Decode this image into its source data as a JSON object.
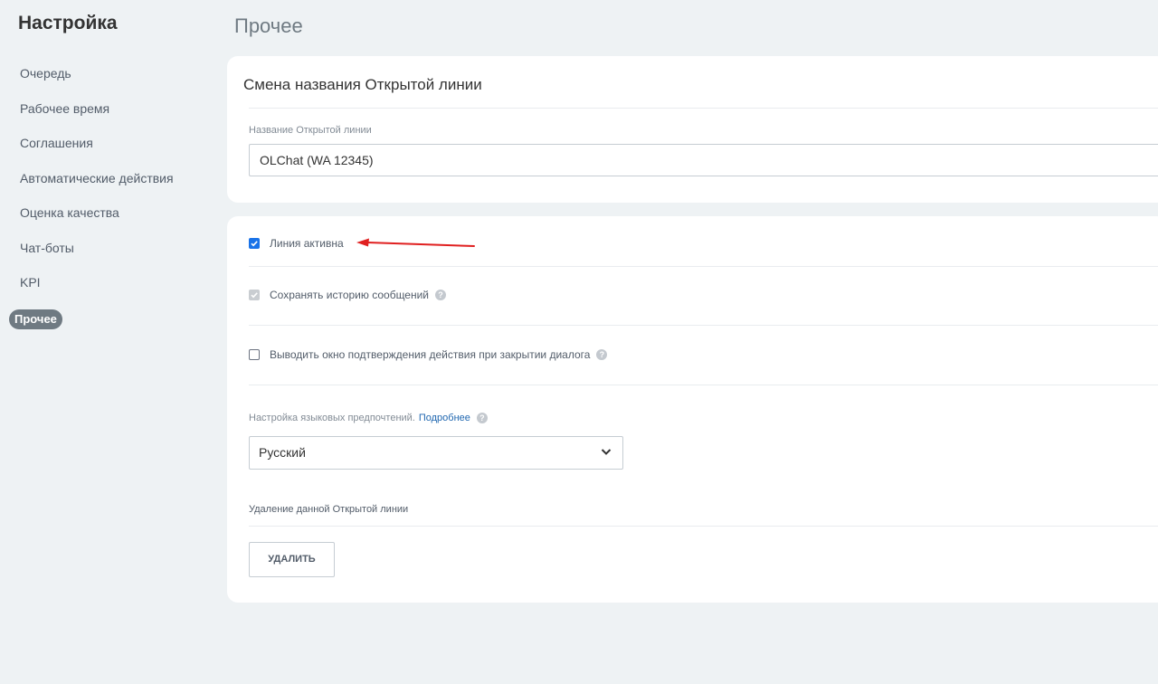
{
  "sidebar": {
    "title": "Настройка",
    "items": [
      {
        "label": "Очередь"
      },
      {
        "label": "Рабочее время"
      },
      {
        "label": "Соглашения"
      },
      {
        "label": "Автоматические действия"
      },
      {
        "label": "Оценка качества"
      },
      {
        "label": "Чат-боты"
      },
      {
        "label": "KPI"
      },
      {
        "label": "Прочее",
        "active": true
      }
    ]
  },
  "main": {
    "title": "Прочее",
    "rename_section": {
      "header": "Смена названия Открытой линии",
      "field_label": "Название Открытой линии",
      "field_value": "OLChat (WA 12345)"
    },
    "options": {
      "line_active": {
        "label": "Линия активна",
        "checked": true
      },
      "save_history": {
        "label": "Сохранять историю сообщений",
        "checked": true,
        "disabled": true
      },
      "confirm_close": {
        "label": "Выводить окно подтверждения действия при закрытии диалога",
        "checked": false
      },
      "language": {
        "label": "Настройка языковых предпочтений.",
        "link": "Подробнее",
        "selected": "Русский"
      },
      "delete": {
        "label": "Удаление данной Открытой линии",
        "button": "УДАЛИТЬ"
      }
    },
    "help_icon_glyph": "?"
  },
  "colors": {
    "background": "#eef2f4",
    "accent": "#1a73e8",
    "annotation": "#e02020",
    "active_nav": "#6f7a82"
  }
}
